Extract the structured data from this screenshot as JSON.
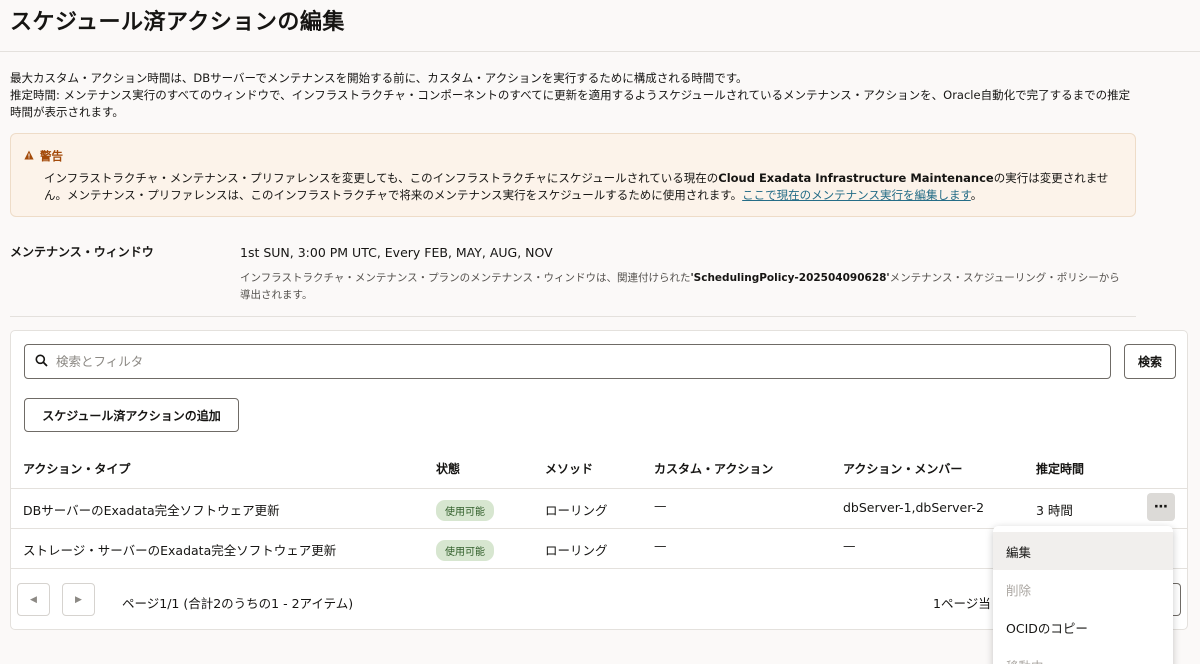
{
  "page": {
    "title": "スケジュール済アクションの編集"
  },
  "description": {
    "line1": "最大カスタム・アクション時間は、DBサーバーでメンテナンスを開始する前に、カスタム・アクションを実行するために構成される時間です。",
    "line2": "推定時間: メンテナンス実行のすべてのウィンドウで、インフラストラクチャ・コンポーネントのすべてに更新を適用するようスケジュールされているメンテナンス・アクションを、Oracle自動化で完了するまでの推定時間が表示されます。"
  },
  "warning": {
    "title": "警告",
    "text_before": "インフラストラクチャ・メンテナンス・プリファレンスを変更しても、このインフラストラクチャにスケジュールされている現在の",
    "bold": "Cloud Exadata Infrastructure Maintenance",
    "text_after": "の実行は変更されません。メンテナンス・プリファレンスは、このインフラストラクチャで将来のメンテナンス実行をスケジュールするために使用されます。",
    "link": "ここで現在のメンテナンス実行を編集します",
    "period": "。"
  },
  "maintenance_window": {
    "label": "メンテナンス・ウィンドウ",
    "value": "1st SUN, 3:00 PM UTC, Every FEB, MAY, AUG, NOV",
    "note_before": "インフラストラクチャ・メンテナンス・プランのメンテナンス・ウィンドウは、関連付けられた",
    "note_bold": "'SchedulingPolicy-202504090628'",
    "note_after": "メンテナンス・スケジューリング・ポリシーから導出されます。"
  },
  "search": {
    "placeholder": "検索とフィルタ",
    "button": "検索"
  },
  "add_button": "スケジュール済アクションの追加",
  "table": {
    "headers": [
      "アクション・タイプ",
      "状態",
      "メソッド",
      "カスタム・アクション",
      "アクション・メンバー",
      "推定時間"
    ],
    "rows": [
      {
        "type": "DBサーバーのExadata完全ソフトウェア更新",
        "status": "使用可能",
        "method": "ローリング",
        "custom": "—",
        "members": "dbServer-1,dbServer-2",
        "time": "3 時間"
      },
      {
        "type": "ストレージ・サーバーのExadata完全ソフトウェア更新",
        "status": "使用可能",
        "method": "ローリング",
        "custom": "—",
        "members": "—",
        "time": ""
      }
    ]
  },
  "pagination": {
    "summary": "ページ1/1 (合計2のうちの1 - 2アイテム)",
    "per_page": "1ページ当"
  },
  "menu": {
    "items": [
      "編集",
      "削除",
      "OCIDのコピー",
      "移動中"
    ]
  },
  "colors": {
    "warning_accent": "#a34a0a",
    "link": "#256d87",
    "badge_bg": "#d7e6d0"
  }
}
